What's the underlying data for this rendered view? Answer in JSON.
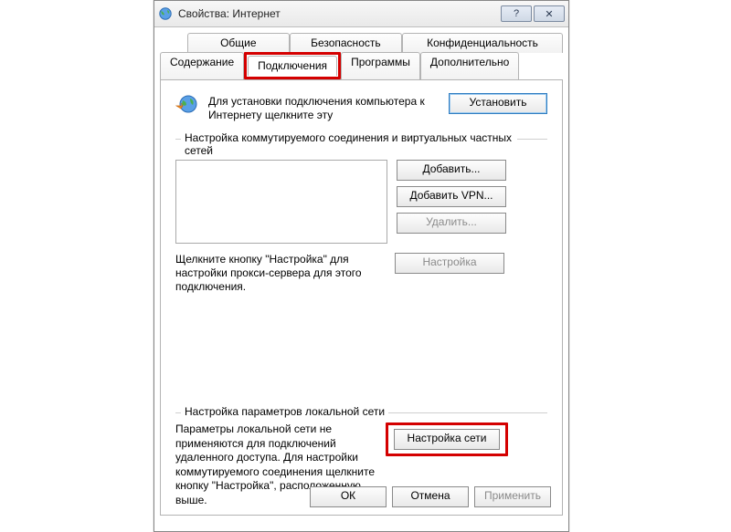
{
  "titlebar": {
    "title": "Свойства: Интернет",
    "help_glyph": "?",
    "close_glyph": "✕"
  },
  "tabs": {
    "row1": [
      {
        "label": "Общие"
      },
      {
        "label": "Безопасность"
      },
      {
        "label": "Конфиденциальность"
      }
    ],
    "row2": [
      {
        "label": "Содержание"
      },
      {
        "label": "Подключения",
        "active": true
      },
      {
        "label": "Программы"
      },
      {
        "label": "Дополнительно"
      }
    ]
  },
  "setup": {
    "text": "Для установки подключения компьютера к Интернету щелкните эту",
    "button": "Установить"
  },
  "dial": {
    "legend": "Настройка коммутируемого соединения и виртуальных частных сетей",
    "add": "Добавить...",
    "add_vpn": "Добавить VPN...",
    "remove": "Удалить...",
    "settings": "Настройка",
    "proxy_hint": "Щелкните кнопку \"Настройка\" для настройки прокси-сервера для этого подключения."
  },
  "lan": {
    "legend": "Настройка параметров локальной сети",
    "text": "Параметры локальной сети не применяются для подключений удаленного доступа. Для настройки коммутируемого соединения щелкните кнопку \"Настройка\", расположенную выше.",
    "button": "Настройка сети"
  },
  "dlg": {
    "ok": "ОК",
    "cancel": "Отмена",
    "apply": "Применить"
  }
}
